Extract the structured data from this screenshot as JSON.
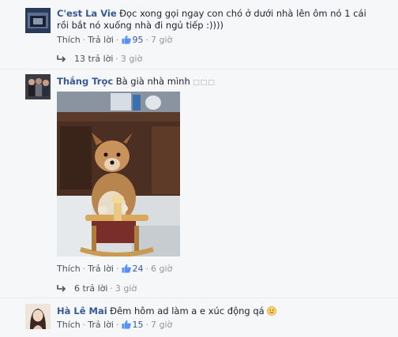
{
  "comments": [
    {
      "author": "C'est La Vie",
      "text": "Đọc xong gọi ngay con chó ở dưới nhà lên ôm nó 1 cái rồi bắt nó xuống nhà đi ngủ tiếp :))))",
      "like_label": "Thích",
      "reply_label": "Trả lời",
      "reactions": "95",
      "time": "7 giờ",
      "replies": "13 trả lời",
      "replies_time": "3 giờ"
    },
    {
      "author": "Thắng Trọc",
      "text": "Bà già nhà mình",
      "emoji_placeholder": "□□□",
      "like_label": "Thích",
      "reply_label": "Trả lời",
      "reactions": "24",
      "time": "6 giờ",
      "replies": "6 trả lời",
      "replies_time": "3 giờ"
    },
    {
      "author": "Hà Lê Mai",
      "text": "Đêm hôm ad làm a e xúc động qá",
      "like_label": "Thích",
      "reply_label": "Trả lời",
      "reactions": "15",
      "time": "7 giờ"
    }
  ],
  "colors": {
    "link": "#365899",
    "meta": "#90949c",
    "background": "#f6f7f9"
  }
}
